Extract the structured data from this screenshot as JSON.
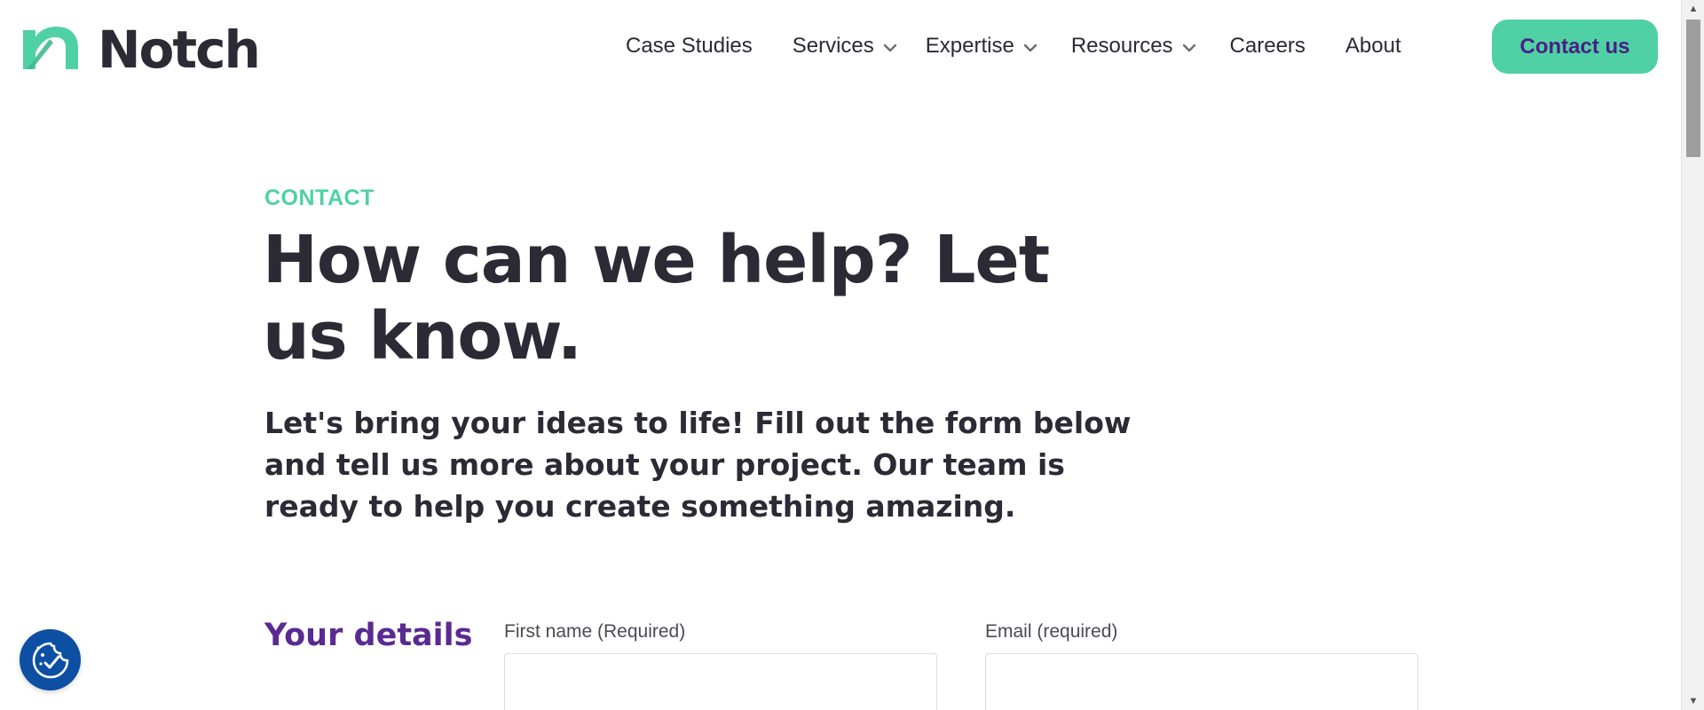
{
  "brand": {
    "name": "Notch",
    "accent_color": "#4fd1a5",
    "dark_color": "#2b2a35",
    "purple_color": "#5a2a91"
  },
  "nav": {
    "items": [
      {
        "label": "Case Studies",
        "has_dropdown": false
      },
      {
        "label": "Services",
        "has_dropdown": true
      },
      {
        "label": "Expertise",
        "has_dropdown": true
      },
      {
        "label": "Resources",
        "has_dropdown": true
      },
      {
        "label": "Careers",
        "has_dropdown": false
      },
      {
        "label": "About",
        "has_dropdown": false
      }
    ],
    "cta_label": "Contact us"
  },
  "hero": {
    "eyebrow": "CONTACT",
    "title": "How can we help? Let us know.",
    "description": "Let's bring your ideas to life! Fill out the form below and tell us more about your project. Our team is ready to help you create something amazing."
  },
  "form": {
    "section_title": "Your details",
    "fields": [
      {
        "label": "First name (Required)",
        "value": ""
      },
      {
        "label": "Email (required)",
        "value": ""
      }
    ]
  },
  "icons": {
    "chevron": "chevron-down-icon",
    "consent": "cookie-consent-icon",
    "scroll_up": "scroll-up-arrow-icon",
    "scroll_down": "scroll-down-arrow-icon"
  }
}
